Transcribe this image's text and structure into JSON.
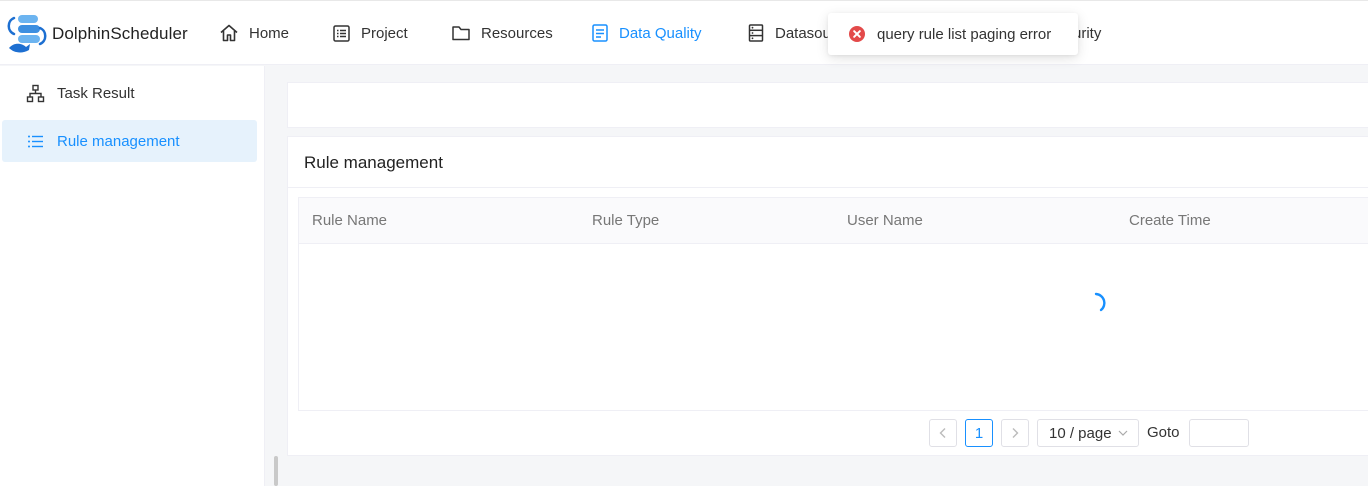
{
  "app": {
    "name": "DolphinScheduler"
  },
  "nav": {
    "items": [
      {
        "label": "Home",
        "icon": "home-icon"
      },
      {
        "label": "Project",
        "icon": "project-icon"
      },
      {
        "label": "Resources",
        "icon": "folder-icon"
      },
      {
        "label": "Data Quality",
        "icon": "data-quality-icon",
        "active": true
      },
      {
        "label": "Datasou",
        "icon": "datasource-icon"
      },
      {
        "label": "urity",
        "icon": "security-icon"
      }
    ]
  },
  "toast": {
    "type": "error",
    "message": "query rule list paging error"
  },
  "sidebar": {
    "items": [
      {
        "label": "Task Result",
        "icon": "task-result-icon"
      },
      {
        "label": "Rule management",
        "icon": "list-icon",
        "active": true
      }
    ]
  },
  "main": {
    "title": "Rule management",
    "table": {
      "columns": [
        "Rule Name",
        "Rule Type",
        "User Name",
        "Create Time"
      ],
      "rows": [],
      "loading": true
    }
  },
  "pagination": {
    "current_page": "1",
    "page_size_label": "10 / page",
    "goto_label": "Goto",
    "goto_value": ""
  },
  "colors": {
    "accent": "#1890ff",
    "error": "#e34a4a",
    "active_bg": "#e6f2fc"
  }
}
